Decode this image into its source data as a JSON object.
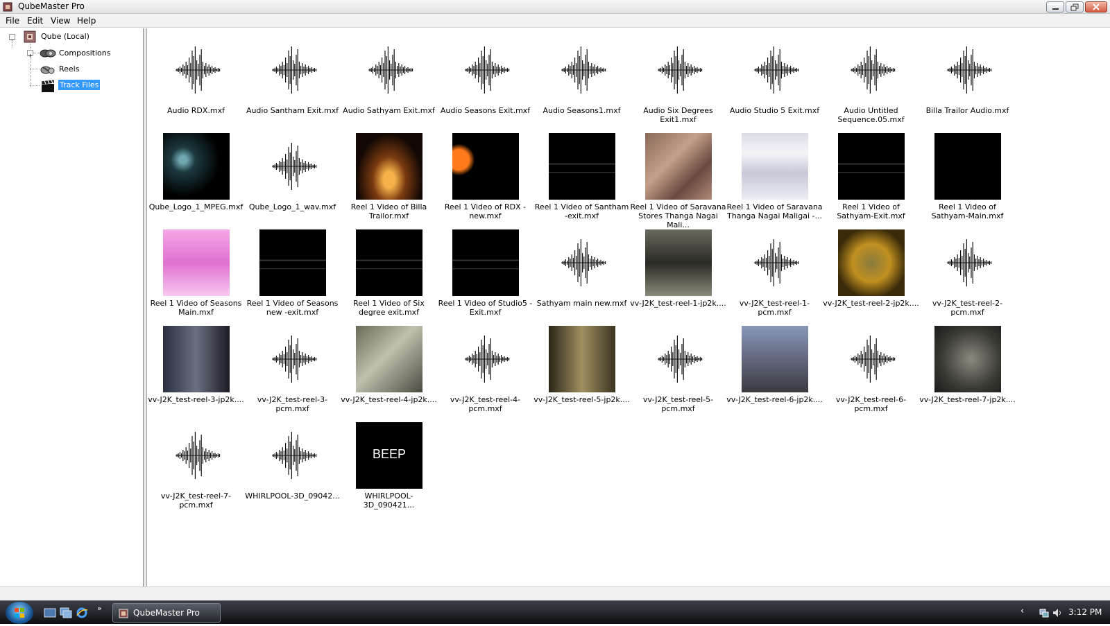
{
  "window": {
    "title": "QubeMaster Pro"
  },
  "menu": {
    "items": [
      "File",
      "Edit",
      "View",
      "Help"
    ]
  },
  "tree": {
    "root": "Qube (Local)",
    "children": [
      "Compositions",
      "Reels",
      "Track Files"
    ],
    "selected": "Track Files"
  },
  "files": [
    {
      "name": "Audio RDX.mxf",
      "type": "audio"
    },
    {
      "name": "Audio Santham Exit.mxf",
      "type": "audio"
    },
    {
      "name": "Audio Sathyam Exit.mxf",
      "type": "audio"
    },
    {
      "name": "Audio Seasons Exit.mxf",
      "type": "audio"
    },
    {
      "name": "Audio Seasons1.mxf",
      "type": "audio"
    },
    {
      "name": "Audio Six Degrees Exit1.mxf",
      "type": "audio"
    },
    {
      "name": "Audio Studio 5 Exit.mxf",
      "type": "audio"
    },
    {
      "name": "Audio Untitled Sequence.05.mxf",
      "type": "audio"
    },
    {
      "name": "Billa Trailor Audio.mxf",
      "type": "audio"
    },
    {
      "name": "Qube_Logo_1_MPEG.mxf",
      "type": "video",
      "look": "dark-teal"
    },
    {
      "name": "Qube_Logo_1_wav.mxf",
      "type": "audio"
    },
    {
      "name": "Reel 1 Video of Billa Trailor.mxf",
      "type": "video",
      "look": "tunnel"
    },
    {
      "name": "Reel 1 Video of RDX - new.mxf",
      "type": "video",
      "look": "orange-arc"
    },
    {
      "name": "Reel 1 Video of Santham -exit.mxf",
      "type": "video",
      "look": "credits"
    },
    {
      "name": "Reel 1 Video of Saravana Stores Thanga Nagai Mali...",
      "type": "video",
      "look": "warm-scene"
    },
    {
      "name": "Reel 1 Video of Saravana Thanga Nagai Maligai -...",
      "type": "video",
      "look": "document"
    },
    {
      "name": "Reel 1 Video of Sathyam-Exit.mxf",
      "type": "video",
      "look": "credits"
    },
    {
      "name": "Reel 1 Video of Sathyam-Main.mxf",
      "type": "video",
      "look": "black"
    },
    {
      "name": "Reel 1 Video of Seasons Main.mxf",
      "type": "video",
      "look": "pink"
    },
    {
      "name": "Reel 1 Video of Seasons new -exit.mxf",
      "type": "video",
      "look": "credits"
    },
    {
      "name": "Reel 1 Video of Six degree exit.mxf",
      "type": "video",
      "look": "credits"
    },
    {
      "name": "Reel 1 Video of Studio5 -Exit.mxf",
      "type": "video",
      "look": "credits"
    },
    {
      "name": "Sathyam main new.mxf",
      "type": "audio"
    },
    {
      "name": "vv-J2K_test-reel-1-jp2k....",
      "type": "video",
      "look": "street"
    },
    {
      "name": "vv-J2K_test-reel-1-pcm.mxf",
      "type": "audio"
    },
    {
      "name": "vv-J2K_test-reel-2-jp2k....",
      "type": "video",
      "look": "fire"
    },
    {
      "name": "vv-J2K_test-reel-2-pcm.mxf",
      "type": "audio"
    },
    {
      "name": "vv-J2K_test-reel-3-jp2k....",
      "type": "video",
      "look": "room"
    },
    {
      "name": "vv-J2K_test-reel-3-pcm.mxf",
      "type": "audio"
    },
    {
      "name": "vv-J2K_test-reel-4-jp2k....",
      "type": "video",
      "look": "crowd"
    },
    {
      "name": "vv-J2K_test-reel-4-pcm.mxf",
      "type": "audio"
    },
    {
      "name": "vv-J2K_test-reel-5-jp2k....",
      "type": "video",
      "look": "corridor"
    },
    {
      "name": "vv-J2K_test-reel-5-pcm.mxf",
      "type": "audio"
    },
    {
      "name": "vv-J2K_test-reel-6-jp2k....",
      "type": "video",
      "look": "outdoor"
    },
    {
      "name": "vv-J2K_test-reel-6-pcm.mxf",
      "type": "audio"
    },
    {
      "name": "vv-J2K_test-reel-7-jp2k....",
      "type": "video",
      "look": "closeup"
    },
    {
      "name": "vv-J2K_test-reel-7-pcm.mxf",
      "type": "audio"
    },
    {
      "name": "WHIRLPOOL-3D_09042...",
      "type": "audio"
    },
    {
      "name": "WHIRLPOOL-3D_090421...",
      "type": "video",
      "look": "beep",
      "overlay": "BEEP"
    }
  ],
  "taskbar": {
    "task_label": "QubeMaster Pro",
    "clock": "3:12 PM"
  },
  "colors": {
    "selection": "#3399ff",
    "taskbar": "#1b1e22"
  }
}
